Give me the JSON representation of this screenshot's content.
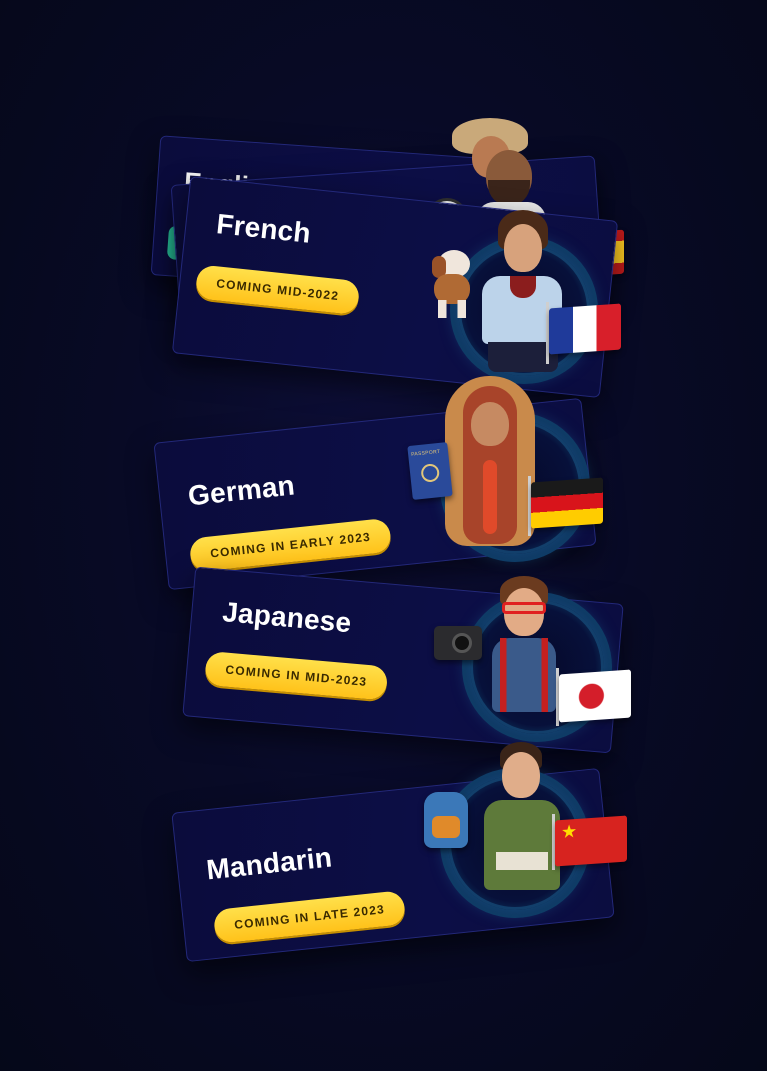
{
  "background_color": "#080a26",
  "pill_color": "#ffd02e",
  "cards": [
    {
      "language": "Englis",
      "badge": ""
    },
    {
      "language": "",
      "badge": ""
    },
    {
      "language": "French",
      "badge": "COMING MID-2022"
    },
    {
      "language": "German",
      "badge": "COMING IN EARLY 2023"
    },
    {
      "language": "Japanese",
      "badge": "COMING IN MID-2023"
    },
    {
      "language": "Mandarin",
      "badge": "COMING IN LATE 2023"
    }
  ],
  "icons": {
    "dog": "dog-icon",
    "passport": "passport-icon",
    "camera": "camera-icon",
    "backpack": "backpack-icon",
    "ball": "soccer-ball-icon"
  },
  "passport_text": "PASSPORT"
}
